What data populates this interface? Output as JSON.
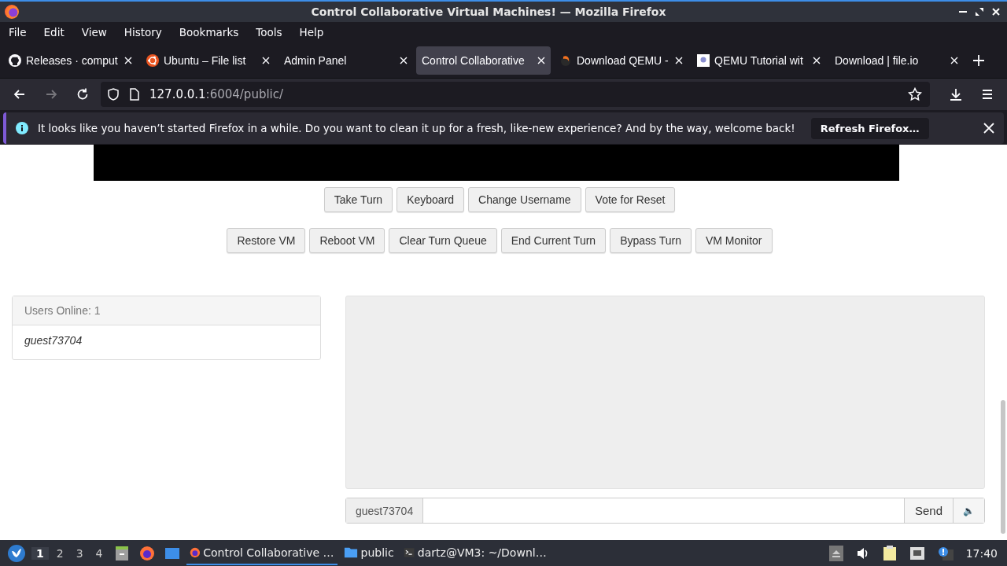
{
  "window": {
    "title": "Control Collaborative Virtual Machines! — Mozilla Firefox"
  },
  "menu": [
    "File",
    "Edit",
    "View",
    "History",
    "Bookmarks",
    "Tools",
    "Help"
  ],
  "tabs": [
    {
      "label": "Releases · comput",
      "selected": false
    },
    {
      "label": "Ubuntu – File list",
      "selected": false
    },
    {
      "label": "Admin Panel",
      "selected": false
    },
    {
      "label": "Control Collaborative",
      "selected": true
    },
    {
      "label": "Download QEMU -",
      "selected": false
    },
    {
      "label": "QEMU Tutorial wit",
      "selected": false
    },
    {
      "label": "Download | file.io",
      "selected": false
    }
  ],
  "url": {
    "host": "127.0.0.1",
    "rest": ":6004/public/"
  },
  "notification": {
    "message": "It looks like you haven’t started Firefox in a while. Do you want to clean it up for a fresh, like-new experience? And by the way, welcome back!",
    "button": "Refresh Firefox…"
  },
  "vm_buttons": [
    [
      "Take Turn",
      "Keyboard",
      "Change Username",
      "Vote for Reset"
    ],
    [
      "Restore VM",
      "Reboot VM",
      "Clear Turn Queue",
      "End Current Turn",
      "Bypass Turn",
      "VM Monitor"
    ]
  ],
  "users": {
    "heading": "Users Online: 1",
    "list": [
      "guest73704"
    ]
  },
  "chat": {
    "username": "guest73704",
    "send": "Send",
    "speaker": "🔈"
  },
  "taskbar": {
    "workspaces": [
      {
        "label": "1",
        "selected": true
      },
      {
        "label": "2",
        "selected": false
      },
      {
        "label": "3",
        "selected": false
      },
      {
        "label": "4",
        "selected": false
      }
    ],
    "windows": [
      {
        "label": "Control Collaborative …",
        "selected": true
      },
      {
        "label": "public",
        "selected": false
      },
      {
        "label": "dartz@VM3: ~/Downl…",
        "selected": false
      }
    ],
    "clock": "17:40"
  }
}
